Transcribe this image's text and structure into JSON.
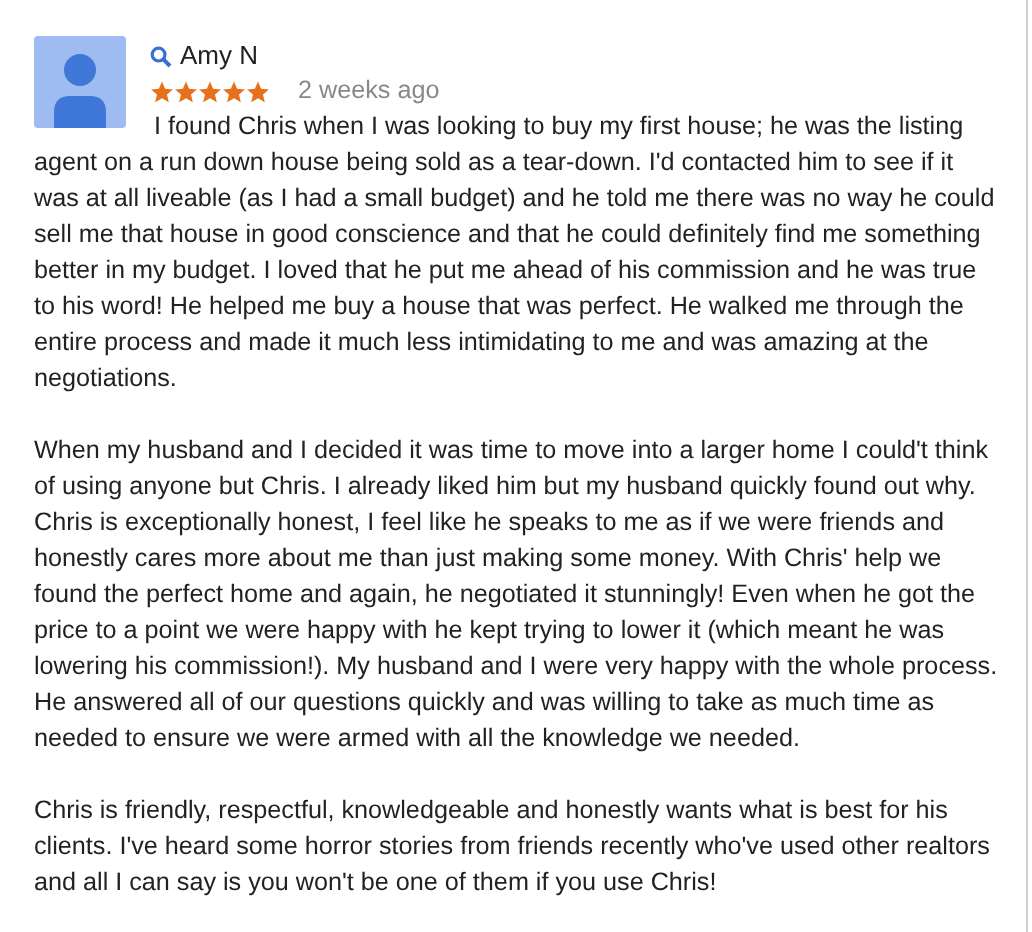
{
  "review": {
    "author": "Amy N",
    "stars": 5,
    "time": "2 weeks ago",
    "paragraphs": [
      "I found Chris when I was looking to buy my first house; he was the listing agent on a run down house being sold as a tear-down. I'd contacted him to see if it was at all liveable (as I had a small budget) and he told me there was no way he could sell me that house in good conscience and that he could definitely find me something better in my budget. I loved that he put me ahead of his commission and he was true to his word! He helped me buy a house that was perfect. He walked me through the entire process and made it much less intimidating to me and was amazing at the negotiations.",
      "When my husband and I decided it was time to move into a larger home I could't think of using anyone but Chris. I already liked him but my husband quickly found out why. Chris is exceptionally honest, I feel like he speaks to me as if we were friends and honestly cares more about me than just making some money. With Chris' help we found the perfect home and again, he negotiated it stunningly! Even when he got the price to a point we were happy with he kept trying to lower it (which meant he was lowering his commission!). My husband and I were very happy with the whole process. He answered all of our questions quickly and was willing to take as much time as needed to ensure we were armed with all the knowledge we needed.",
      "Chris is friendly, respectful, knowledgeable and honestly wants what is best for his clients. I've heard some horror stories from friends recently who've used other realtors and all I can say is you won't be one of them if you use Chris!"
    ]
  }
}
